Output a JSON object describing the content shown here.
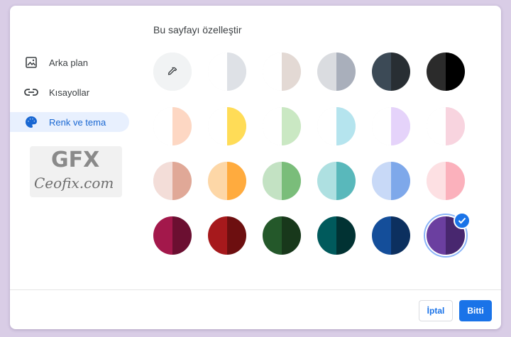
{
  "dialog": {
    "title": "Bu sayfayı özelleştir",
    "sidebar": [
      {
        "label": "Arka plan",
        "icon": "image-icon",
        "active": false
      },
      {
        "label": "Kısayollar",
        "icon": "link-icon",
        "active": false
      },
      {
        "label": "Renk ve tema",
        "icon": "palette-icon",
        "active": true
      }
    ],
    "watermark": {
      "logo": "GFX",
      "text": "Ceofix.com"
    },
    "buttons": {
      "cancel": "İptal",
      "done": "Bitti"
    }
  },
  "themes": [
    {
      "left": "#f1f3f4",
      "right": "#f1f3f4",
      "custom": true
    },
    {
      "left": "#ffffff",
      "right": "#dee1e6"
    },
    {
      "left": "#ffffff",
      "right": "#e3d9d4"
    },
    {
      "left": "#dadce0",
      "right": "#a9afbb"
    },
    {
      "left": "#3c4a56",
      "right": "#282e33"
    },
    {
      "left": "#2b2b2b",
      "right": "#000000"
    },
    {
      "left": "#ffffff",
      "right": "#fdd7c3"
    },
    {
      "left": "#ffffff",
      "right": "#ffdc57"
    },
    {
      "left": "#ffffff",
      "right": "#cae8c3"
    },
    {
      "left": "#ffffff",
      "right": "#b5e4ee"
    },
    {
      "left": "#ffffff",
      "right": "#e5d3fa"
    },
    {
      "left": "#ffffff",
      "right": "#f8d4df"
    },
    {
      "left": "#f3ddd8",
      "right": "#e0a897"
    },
    {
      "left": "#fdd7a7",
      "right": "#ffab3e"
    },
    {
      "left": "#c3e2c3",
      "right": "#7abd7a"
    },
    {
      "left": "#aee0e1",
      "right": "#59b8bb"
    },
    {
      "left": "#c8d9f7",
      "right": "#7ea8ea"
    },
    {
      "left": "#fde0e3",
      "right": "#fbb1bc"
    },
    {
      "left": "#a3184b",
      "right": "#6b0f31"
    },
    {
      "left": "#a6191c",
      "right": "#6d0f10"
    },
    {
      "left": "#24582a",
      "right": "#18381b"
    },
    {
      "left": "#005a5c",
      "right": "#013233"
    },
    {
      "left": "#144e9a",
      "right": "#0c305f"
    },
    {
      "left": "#6b3fa0",
      "right": "#48276f",
      "selected": true
    }
  ]
}
